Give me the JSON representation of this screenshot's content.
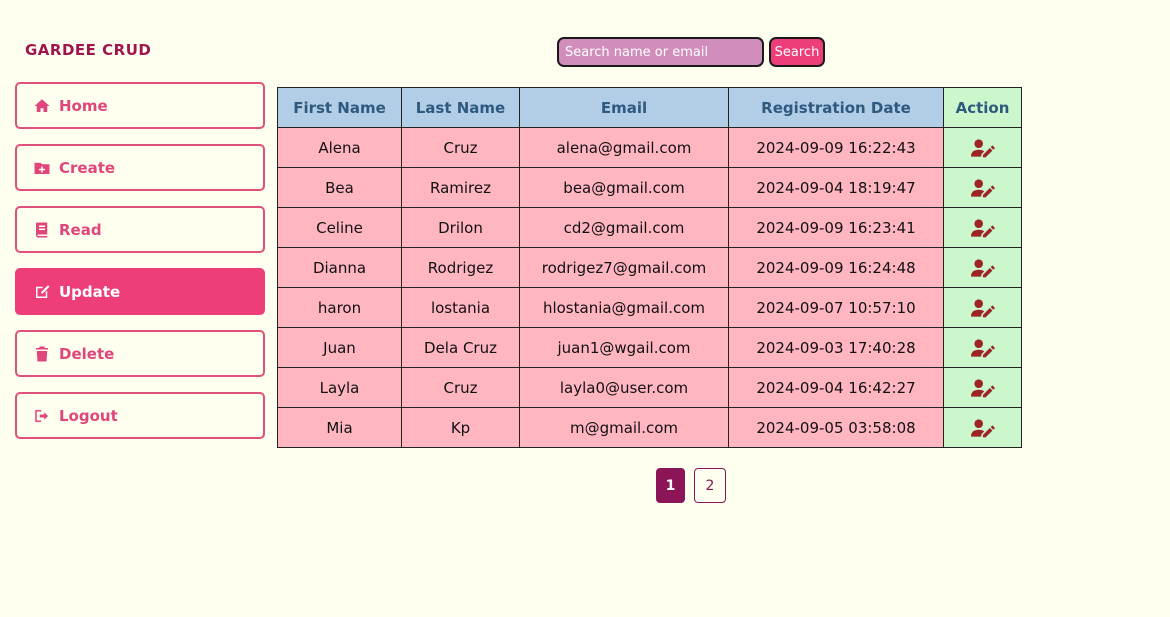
{
  "app": {
    "brand": "GARDEE CRUD"
  },
  "sidebar": {
    "items": [
      {
        "label": "Home",
        "icon": "home-icon",
        "active": false
      },
      {
        "label": "Create",
        "icon": "folder-plus-icon",
        "active": false
      },
      {
        "label": "Read",
        "icon": "book-icon",
        "active": false
      },
      {
        "label": "Update",
        "icon": "edit-icon",
        "active": true
      },
      {
        "label": "Delete",
        "icon": "trash-icon",
        "active": false
      },
      {
        "label": "Logout",
        "icon": "sign-out-icon",
        "active": false
      }
    ]
  },
  "search": {
    "placeholder": "Search name or email",
    "value": "",
    "button_label": "Search"
  },
  "table": {
    "headers": [
      "First Name",
      "Last Name",
      "Email",
      "Registration Date",
      "Action"
    ],
    "rows": [
      [
        "Alena",
        "Cruz",
        "alena@gmail.com",
        "2024-09-09 16:22:43"
      ],
      [
        "Bea",
        "Ramirez",
        "bea@gmail.com",
        "2024-09-04 18:19:47"
      ],
      [
        "Celine",
        "Drilon",
        "cd2@gmail.com",
        "2024-09-09 16:23:41"
      ],
      [
        "Dianna",
        "Rodrigez",
        "rodrigez7@gmail.com",
        "2024-09-09 16:24:48"
      ],
      [
        "haron",
        "lostania",
        "hlostania@gmail.com",
        "2024-09-07 10:57:10"
      ],
      [
        "Juan",
        "Dela Cruz",
        "juan1@wgail.com",
        "2024-09-03 17:40:28"
      ],
      [
        "Layla",
        "Cruz",
        "layla0@user.com",
        "2024-09-04 16:42:27"
      ],
      [
        "Mia",
        "Kp",
        "m@gmail.com",
        "2024-09-05 03:58:08"
      ]
    ],
    "action_icon": "user-edit-icon"
  },
  "pagination": {
    "pages": [
      "1",
      "2"
    ],
    "current": "1"
  },
  "colors": {
    "background": "#fffff0",
    "accent": "#ee3e79",
    "brand": "#a0154b",
    "header_bg": "#b2cde6",
    "row_bg": "#ffb6c1",
    "action_bg": "#ccf7cc",
    "pager": "#8b1557"
  }
}
